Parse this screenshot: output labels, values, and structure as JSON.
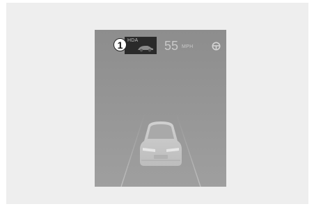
{
  "callout": {
    "number": "1"
  },
  "cluster": {
    "hda_label": "HDA",
    "speed_value": "55",
    "speed_unit": "MPH",
    "icons": [
      "hda-car-icon",
      "steering-wheel-icon",
      "lane-lines-icon",
      "vehicle-rear-icon"
    ]
  }
}
